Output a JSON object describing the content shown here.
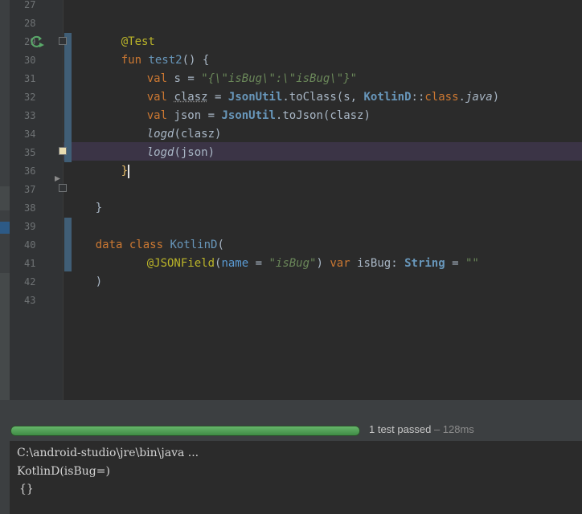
{
  "editor": {
    "line_numbers": [
      "27",
      "28",
      "29",
      "30",
      "31",
      "32",
      "33",
      "34",
      "35",
      "36",
      "37",
      "38",
      "39",
      "40",
      "41",
      "42",
      "43"
    ],
    "code": {
      "l28": {
        "annotation": "@Test"
      },
      "l29": {
        "kw": "fun",
        "name": "test2",
        "rest": "() {"
      },
      "l30": {
        "kw": "val",
        "var": "s",
        "eq": " = ",
        "str": "\"{\\\"isBug\\\":\\\"isBug\\\"}\""
      },
      "l31": {
        "kw": "val",
        "var": "clasz",
        "eq": " = ",
        "cls": "JsonUtil",
        "call": ".toClass(s, ",
        "cls2": "KotlinD",
        "sep": "::",
        "kw2": "class",
        "dot": ".",
        "java": "java",
        "close": ")"
      },
      "l32": {
        "kw": "val",
        "var": "json",
        "eq": " = ",
        "cls": "JsonUtil",
        "call": ".toJson(clasz)"
      },
      "l33": {
        "fn": "logd",
        "args": "(clasz)"
      },
      "l34": {
        "fn": "logd",
        "args": "(json)"
      },
      "l35": {
        "brace": "}"
      },
      "l37": {
        "brace": "}"
      },
      "l39": {
        "kw": "data class",
        "name": "KotlinD",
        "open": "("
      },
      "l40": {
        "ann": "@JSONField",
        "open": "(",
        "param": "name",
        "eq": " = ",
        "str": "\"isBug\"",
        "close": ")",
        "kw": " var ",
        "var": "isBug",
        "colon": ": ",
        "type": "String",
        "eq2": " = ",
        "str2": "\"\""
      },
      "l41": {
        "close": ")"
      }
    }
  },
  "run": {
    "progress": 1.0,
    "status": "1 test passed",
    "time": " – 128ms",
    "console": [
      "C:\\android-studio\\jre\\bin\\java ...",
      "KotlinD(isBug=)",
      "{}"
    ]
  },
  "colors": {
    "accent": "#3f8b45",
    "editor_bg": "#2b2b2b",
    "current_line": "#3b3446"
  }
}
